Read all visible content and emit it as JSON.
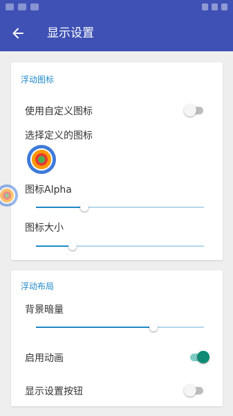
{
  "app_bar": {
    "title": "显示设置"
  },
  "floating_icon": {
    "section_title": "浮动图标",
    "use_custom_icon": {
      "label": "使用自定义图标",
      "enabled": false
    },
    "choose_icon": {
      "label": "选择定义的图标"
    },
    "icon_alpha": {
      "label": "图标Alpha",
      "value": 0.29
    },
    "icon_size": {
      "label": "图标大小",
      "value": 0.22
    }
  },
  "floating_layout": {
    "section_title": "浮动布局",
    "background_dim": {
      "label": "背景暗量",
      "value": 0.7
    },
    "enable_animation": {
      "label": "启用动画",
      "enabled": true
    },
    "show_settings_button": {
      "label": "显示设置按钮",
      "enabled": false
    }
  },
  "colors": {
    "app_bar": "#3f51b5",
    "accent": "#1e88c8",
    "switch_on": "#0f8a74"
  }
}
